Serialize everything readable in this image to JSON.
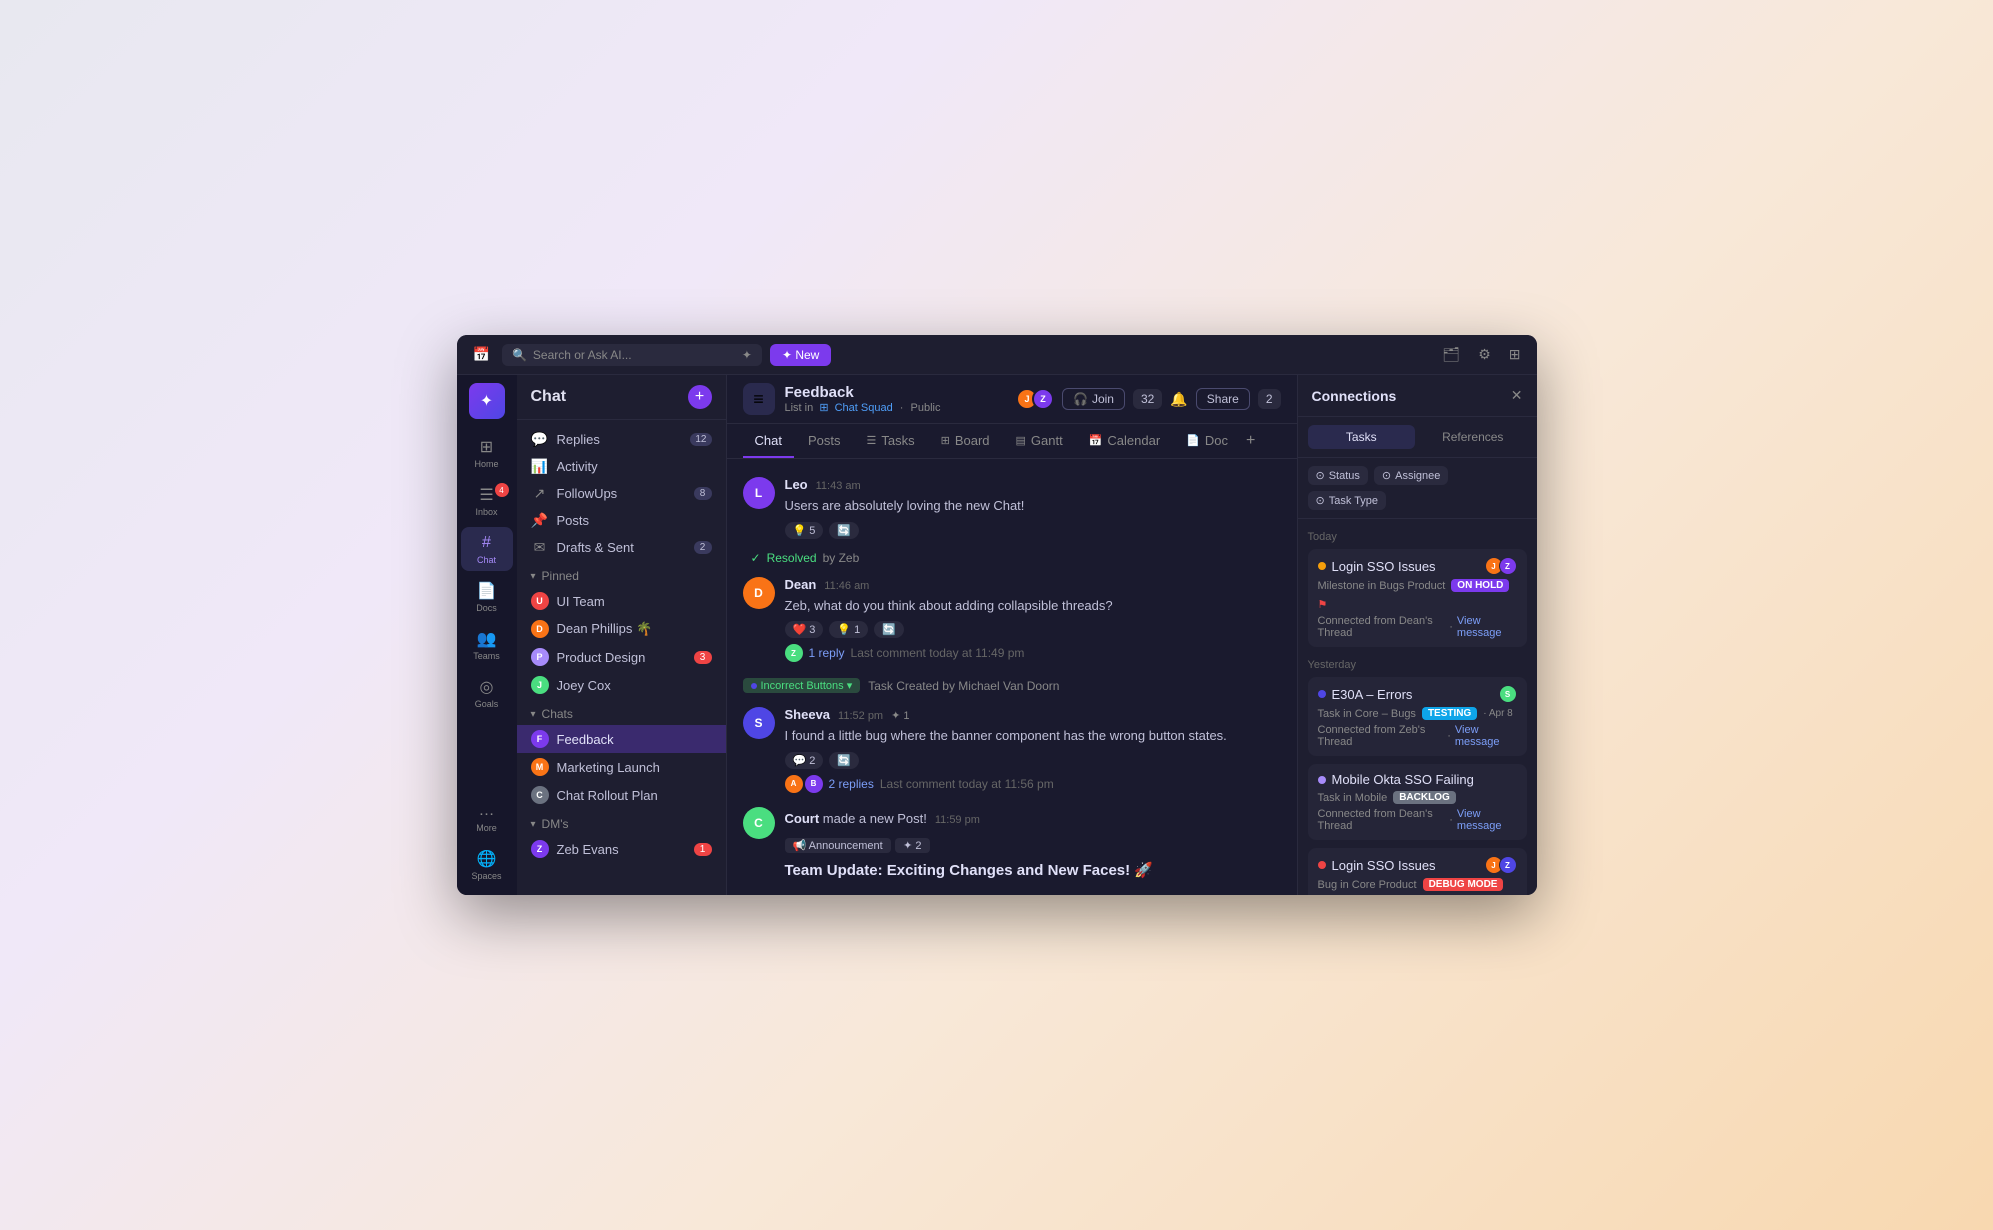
{
  "topbar": {
    "search_placeholder": "Search or Ask AI...",
    "ai_label": "✦",
    "new_label": "✦ New",
    "new_icon": "✦"
  },
  "far_nav": {
    "logo": "✦",
    "items": [
      {
        "id": "home",
        "icon": "⊞",
        "label": "Home",
        "active": false
      },
      {
        "id": "inbox",
        "icon": "☰",
        "label": "Inbox",
        "active": false,
        "badge": "4"
      },
      {
        "id": "chat",
        "icon": "#",
        "label": "Chat",
        "active": true,
        "badge": ""
      },
      {
        "id": "docs",
        "icon": "📄",
        "label": "Docs",
        "active": false
      },
      {
        "id": "teams",
        "icon": "👥",
        "label": "Teams",
        "active": false
      },
      {
        "id": "goals",
        "icon": "◎",
        "label": "Goals",
        "active": false
      },
      {
        "id": "more",
        "icon": "…",
        "label": "More",
        "active": false
      },
      {
        "id": "spaces",
        "icon": "🌐",
        "label": "Spaces",
        "active": false
      }
    ]
  },
  "sidebar": {
    "title": "Chat",
    "direct_items": [
      {
        "id": "replies",
        "icon": "💬",
        "label": "Replies",
        "badge": "12"
      },
      {
        "id": "activity",
        "icon": "📊",
        "label": "Activity",
        "badge": ""
      },
      {
        "id": "followups",
        "icon": "↗",
        "label": "FollowUps",
        "badge": "8"
      },
      {
        "id": "posts",
        "icon": "📌",
        "label": "Posts",
        "badge": ""
      },
      {
        "id": "drafts",
        "icon": "✉",
        "label": "Drafts & Sent",
        "badge": "2"
      }
    ],
    "pinned_section": "Pinned",
    "pinned_items": [
      {
        "id": "ui-team",
        "label": "UI Team",
        "color": "#ef4444"
      },
      {
        "id": "dean-phillips",
        "label": "Dean Phillips 🌴",
        "color": "#f97316"
      },
      {
        "id": "product-design",
        "label": "Product Design",
        "color": "#a78bfa",
        "badge": "3"
      },
      {
        "id": "joey-cox",
        "label": "Joey Cox",
        "color": "#4ade80"
      }
    ],
    "chats_section": "Chats",
    "chats_items": [
      {
        "id": "feedback",
        "label": "Feedback",
        "color": "#7c3aed",
        "active": true
      },
      {
        "id": "marketing",
        "label": "Marketing Launch",
        "color": "#f97316"
      },
      {
        "id": "chat-rollout",
        "label": "Chat Rollout Plan",
        "color": "#6b7280"
      }
    ],
    "dms_section": "DM's",
    "dms_items": [
      {
        "id": "zeb-evans",
        "label": "Zeb Evans",
        "color": "#7c3aed",
        "badge": "1"
      }
    ]
  },
  "chat_header": {
    "title": "Feedback",
    "subtitle_list": "List in",
    "subtitle_squad": "Chat Squad",
    "subtitle_visibility": "Public",
    "join_label": "Join",
    "member_count": "32",
    "share_label": "Share",
    "num_badge": "2"
  },
  "chat_tabs": [
    {
      "id": "chat",
      "label": "Chat",
      "active": true
    },
    {
      "id": "posts",
      "label": "Posts",
      "active": false
    },
    {
      "id": "tasks",
      "label": "Tasks",
      "icon": "☰",
      "active": false
    },
    {
      "id": "board",
      "label": "Board",
      "icon": "⊞",
      "active": false
    },
    {
      "id": "gantt",
      "label": "Gantt",
      "icon": "▤",
      "active": false
    },
    {
      "id": "calendar",
      "label": "Calendar",
      "icon": "📅",
      "active": false
    },
    {
      "id": "doc",
      "label": "Doc",
      "icon": "📄",
      "active": false
    }
  ],
  "messages": [
    {
      "id": "msg1",
      "author": "Leo",
      "time": "11:43 am",
      "avatar_color": "#7c3aed",
      "text": "Users are absolutely loving the new Chat!",
      "reactions": [
        {
          "icon": "💡",
          "count": "5"
        },
        {
          "icon": "🔄",
          "count": ""
        }
      ],
      "replies": null
    },
    {
      "id": "resolved",
      "type": "resolved",
      "resolved_by": "Zeb"
    },
    {
      "id": "msg2",
      "author": "Dean",
      "time": "11:46 am",
      "avatar_color": "#f97316",
      "text": "Zeb, what do you think about adding collapsible threads?",
      "reactions": [
        {
          "icon": "❤️",
          "count": "3"
        },
        {
          "icon": "💡",
          "count": "1"
        },
        {
          "icon": "🔄",
          "count": ""
        }
      ],
      "replies": {
        "count": "1",
        "time": "today at 11:49 pm",
        "avatar_color": "#4ade80"
      }
    },
    {
      "id": "task-msg",
      "type": "task",
      "task_label": "Incorrect Buttons",
      "task_created_by": "Task Created by Michael Van Doorn"
    },
    {
      "id": "msg3",
      "author": "Sheeva",
      "time": "11:52 pm",
      "avatar_color": "#4f46e5",
      "text": "I found a little bug where the banner component has the wrong button states.",
      "reactions": [
        {
          "icon": "💬",
          "count": "2"
        },
        {
          "icon": "🔄",
          "count": ""
        }
      ],
      "replies": {
        "count": "2",
        "time": "today at 11:56 pm",
        "avatar_color": "#f97316",
        "avatar2_color": "#7c3aed"
      }
    },
    {
      "id": "msg4",
      "type": "post",
      "author": "Court",
      "time": "11:59 pm",
      "notice": "Court made a new Post!",
      "tags": [
        {
          "icon": "📢",
          "label": "Announcement"
        },
        {
          "icon": "✦",
          "label": "2"
        }
      ],
      "post_title": "Team Update: Exciting Changes and New Faces! 🚀"
    }
  ],
  "connections": {
    "title": "Connections",
    "tabs": [
      {
        "id": "tasks",
        "label": "Tasks",
        "active": true
      },
      {
        "id": "references",
        "label": "References",
        "active": false
      }
    ],
    "filters": [
      {
        "label": "Status"
      },
      {
        "label": "Assignee"
      },
      {
        "label": "Task Type"
      }
    ],
    "today_label": "Today",
    "yesterday_label": "Yesterday",
    "cards": [
      {
        "id": "card1",
        "section": "today",
        "dot_color": "#f59e0b",
        "title": "Login SSO Issues",
        "subtitle": "Milestone in Bugs Product",
        "status": "ON HOLD",
        "status_class": "status-on-hold",
        "flag": true,
        "connected_from": "Connected from Dean's Thread",
        "view_message": "View message",
        "avatars": [
          {
            "color": "#f97316"
          },
          {
            "color": "#7c3aed"
          }
        ]
      },
      {
        "id": "card2",
        "section": "yesterday",
        "dot_color": "#4f46e5",
        "title": "E30A – Errors",
        "subtitle": "Task in Core – Bugs",
        "status": "TESTING",
        "status_class": "status-testing",
        "date": "Apr 8",
        "connected_from": "Connected from Zeb's Thread",
        "view_message": "View message",
        "avatars": [
          {
            "color": "#4ade80"
          }
        ]
      },
      {
        "id": "card3",
        "section": "yesterday",
        "dot_color": "#a78bfa",
        "title": "Mobile Okta SSO Failing",
        "subtitle": "Task in Mobile",
        "status": "BACKLOG",
        "status_class": "status-backlog",
        "connected_from": "Connected from Dean's Thread",
        "view_message": "View message",
        "avatars": []
      },
      {
        "id": "card4",
        "section": "yesterday",
        "dot_color": "#ef4444",
        "title": "Login SSO Issues",
        "subtitle": "Bug in Core Product",
        "status": "DEBUG MODE",
        "status_class": "status-debug",
        "connected_from": "",
        "view_message": "",
        "avatars": [
          {
            "color": "#f97316"
          },
          {
            "color": "#4f46e5"
          }
        ]
      }
    ]
  }
}
